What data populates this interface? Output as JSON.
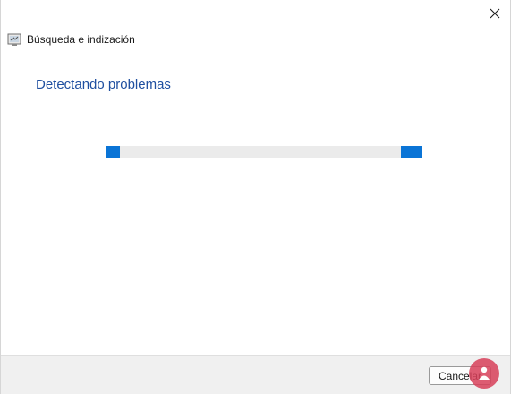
{
  "window": {
    "title": "Búsqueda e indización"
  },
  "main": {
    "heading": "Detectando problemas"
  },
  "progress": {
    "state": "indeterminate",
    "color": "#0a74d6"
  },
  "footer": {
    "cancel_label": "Cancelar"
  },
  "icons": {
    "close": "close-icon",
    "app": "troubleshooter-app-icon",
    "watermark": "watermark-logo"
  }
}
